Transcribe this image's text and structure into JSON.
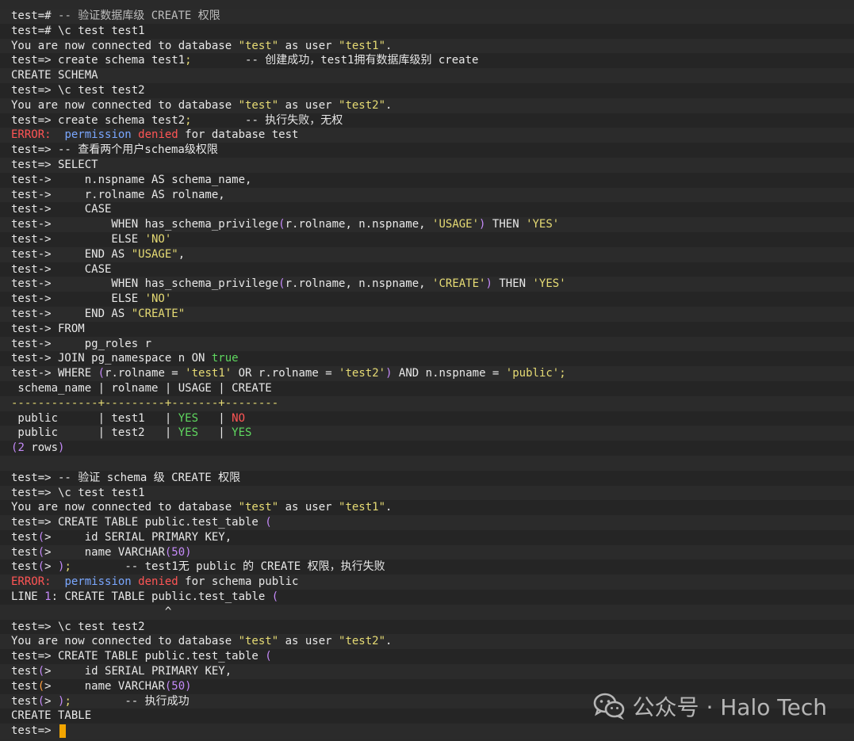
{
  "terminal": {
    "lines": [
      [
        {
          "t": "test=# "
        },
        {
          "t": "-- 验证数据库级 CREATE 权限",
          "c": "c-dim"
        }
      ],
      [
        {
          "t": "test=# \\c test test1"
        }
      ],
      [
        {
          "t": "You are now connected to database "
        },
        {
          "t": "\"test\"",
          "c": "c-yel"
        },
        {
          "t": " as user "
        },
        {
          "t": "\"test1\"",
          "c": "c-yel"
        },
        {
          "t": "."
        }
      ],
      [
        {
          "t": "test=> create schema test1"
        },
        {
          "t": ";",
          "c": "c-yel"
        },
        {
          "t": "        -- 创建成功，test1拥有数据库级别 create"
        }
      ],
      [
        {
          "t": "CREATE SCHEMA"
        }
      ],
      [
        {
          "t": "test=> \\c test test2"
        }
      ],
      [
        {
          "t": "You are now connected to database "
        },
        {
          "t": "\"test\"",
          "c": "c-yel"
        },
        {
          "t": " as user "
        },
        {
          "t": "\"test2\"",
          "c": "c-yel"
        },
        {
          "t": "."
        }
      ],
      [
        {
          "t": "test=> create schema test2"
        },
        {
          "t": ";",
          "c": "c-yel"
        },
        {
          "t": "        -- 执行失败，无权"
        }
      ],
      [
        {
          "t": "ERROR:",
          "c": "c-red"
        },
        {
          "t": "  "
        },
        {
          "t": "permission ",
          "c": "c-blu"
        },
        {
          "t": "denied",
          "c": "c-red"
        },
        {
          "t": " for database test"
        }
      ],
      [
        {
          "t": "test=> -- 查看两个用户schema级权限"
        }
      ],
      [
        {
          "t": "test=> SELECT"
        }
      ],
      [
        {
          "t": "test->     n.nspname AS schema_name,"
        }
      ],
      [
        {
          "t": "test->     r.rolname AS rolname,"
        }
      ],
      [
        {
          "t": "test->     CASE"
        }
      ],
      [
        {
          "t": "test->         WHEN has_schema_privilege"
        },
        {
          "t": "(",
          "c": "c-pur"
        },
        {
          "t": "r.rolname, n.nspname, "
        },
        {
          "t": "'USAGE'",
          "c": "c-yel"
        },
        {
          "t": ")",
          "c": "c-pur"
        },
        {
          "t": " THEN "
        },
        {
          "t": "'YES'",
          "c": "c-yel"
        }
      ],
      [
        {
          "t": "test->         ELSE "
        },
        {
          "t": "'NO'",
          "c": "c-yel"
        }
      ],
      [
        {
          "t": "test->     END AS "
        },
        {
          "t": "\"USAGE\"",
          "c": "c-yel"
        },
        {
          "t": ","
        }
      ],
      [
        {
          "t": "test->     CASE"
        }
      ],
      [
        {
          "t": "test->         WHEN has_schema_privilege"
        },
        {
          "t": "(",
          "c": "c-pur"
        },
        {
          "t": "r.rolname, n.nspname, "
        },
        {
          "t": "'CREATE'",
          "c": "c-yel"
        },
        {
          "t": ")",
          "c": "c-pur"
        },
        {
          "t": " THEN "
        },
        {
          "t": "'YES'",
          "c": "c-yel"
        }
      ],
      [
        {
          "t": "test->         ELSE "
        },
        {
          "t": "'NO'",
          "c": "c-yel"
        }
      ],
      [
        {
          "t": "test->     END AS "
        },
        {
          "t": "\"CREATE\"",
          "c": "c-yel"
        }
      ],
      [
        {
          "t": "test-> FROM"
        }
      ],
      [
        {
          "t": "test->     pg_roles r"
        }
      ],
      [
        {
          "t": "test-> JOIN pg_namespace n ON "
        },
        {
          "t": "true",
          "c": "c-grn"
        }
      ],
      [
        {
          "t": "test-> WHERE "
        },
        {
          "t": "(",
          "c": "c-pur"
        },
        {
          "t": "r.rolname = "
        },
        {
          "t": "'test1'",
          "c": "c-yel"
        },
        {
          "t": " OR r.rolname = "
        },
        {
          "t": "'test2'",
          "c": "c-yel"
        },
        {
          "t": ")",
          "c": "c-pur"
        },
        {
          "t": " AND n.nspname = "
        },
        {
          "t": "'public'",
          "c": "c-yel"
        },
        {
          "t": ";",
          "c": "c-yel"
        }
      ],
      [
        {
          "t": " schema_name | rolname | USAGE | CREATE"
        }
      ],
      [
        {
          "t": "-------------+---------+-------+--------",
          "c": "c-yel"
        }
      ],
      [
        {
          "t": " public      | test1   | "
        },
        {
          "t": "YES",
          "c": "c-grn"
        },
        {
          "t": "   | "
        },
        {
          "t": "NO",
          "c": "c-red"
        }
      ],
      [
        {
          "t": " public      | test2   | "
        },
        {
          "t": "YES",
          "c": "c-grn"
        },
        {
          "t": "   | "
        },
        {
          "t": "YES",
          "c": "c-grn"
        }
      ],
      [
        {
          "t": "(",
          "c": "c-pur"
        },
        {
          "t": "2",
          "c": "c-pur"
        },
        {
          "t": " rows"
        },
        {
          "t": ")",
          "c": "c-pur"
        }
      ],
      [
        {
          "t": " "
        }
      ],
      [
        {
          "t": "test=> -- 验证 schema 级 CREATE 权限"
        }
      ],
      [
        {
          "t": "test=> \\c test test1"
        }
      ],
      [
        {
          "t": "You are now connected to database "
        },
        {
          "t": "\"test\"",
          "c": "c-yel"
        },
        {
          "t": " as user "
        },
        {
          "t": "\"test1\"",
          "c": "c-yel"
        },
        {
          "t": "."
        }
      ],
      [
        {
          "t": "test=> CREATE TABLE public.test_table "
        },
        {
          "t": "(",
          "c": "c-pur"
        }
      ],
      [
        {
          "t": "test"
        },
        {
          "t": "(",
          "c": "c-pur"
        },
        {
          "t": ">     id SERIAL PRIMARY KEY,"
        }
      ],
      [
        {
          "t": "test"
        },
        {
          "t": "(",
          "c": "c-pur"
        },
        {
          "t": ">     name VARCHAR"
        },
        {
          "t": "(50)",
          "c": "c-pur"
        }
      ],
      [
        {
          "t": "test"
        },
        {
          "t": "(",
          "c": "c-pur"
        },
        {
          "t": "> "
        },
        {
          "t": ")",
          "c": "c-pur"
        },
        {
          "t": ";",
          "c": "c-yel"
        },
        {
          "t": "        -- test1无 public 的 CREATE 权限，执行失败"
        }
      ],
      [
        {
          "t": "ERROR:",
          "c": "c-red"
        },
        {
          "t": "  "
        },
        {
          "t": "permission ",
          "c": "c-blu"
        },
        {
          "t": "denied",
          "c": "c-red"
        },
        {
          "t": " for schema public"
        }
      ],
      [
        {
          "t": "LINE "
        },
        {
          "t": "1",
          "c": "c-pur"
        },
        {
          "t": ": CREATE TABLE public.test_table "
        },
        {
          "t": "(",
          "c": "c-pur"
        }
      ],
      [
        {
          "t": "                       ^"
        }
      ],
      [
        {
          "t": "test=> \\c test test2"
        }
      ],
      [
        {
          "t": "You are now connected to database "
        },
        {
          "t": "\"test\"",
          "c": "c-yel"
        },
        {
          "t": " as user "
        },
        {
          "t": "\"test2\"",
          "c": "c-yel"
        },
        {
          "t": "."
        }
      ],
      [
        {
          "t": "test=> CREATE TABLE public.test_table "
        },
        {
          "t": "(",
          "c": "c-pur"
        }
      ],
      [
        {
          "t": "test"
        },
        {
          "t": "(",
          "c": "c-pur"
        },
        {
          "t": ">     id SERIAL PRIMARY KEY,"
        }
      ],
      [
        {
          "t": "test"
        },
        {
          "t": "(",
          "c": "c-org"
        },
        {
          "t": ">     name VARCHAR"
        },
        {
          "t": "(50)",
          "c": "c-pur"
        }
      ],
      [
        {
          "t": "test"
        },
        {
          "t": "(",
          "c": "c-pur"
        },
        {
          "t": "> "
        },
        {
          "t": ")",
          "c": "c-pur"
        },
        {
          "t": ";",
          "c": "c-yel"
        },
        {
          "t": "        -- 执行成功"
        }
      ],
      [
        {
          "t": "CREATE TABLE"
        }
      ],
      [
        {
          "t": "test=> "
        }
      ]
    ]
  },
  "watermark": {
    "icon": "wechat-icon",
    "text": "公众号 · Halo Tech"
  },
  "colors": {
    "background": "#2a2a2a",
    "cursor": "#f2a500"
  }
}
